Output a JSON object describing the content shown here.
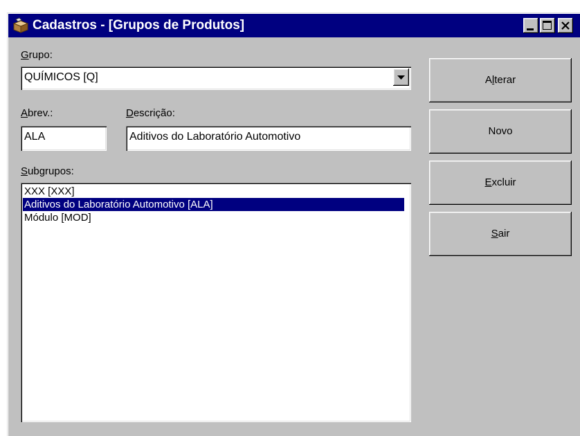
{
  "window": {
    "title": "Cadastros - [Grupos de Produtos]",
    "icon": "boxes-icon",
    "controls": [
      "minimize-icon",
      "maximize-icon",
      "close-icon"
    ]
  },
  "form": {
    "grupo": {
      "label_u": "G",
      "label_rest": "rupo:",
      "value": "QUÍMICOS [Q]"
    },
    "abrev": {
      "label_u": "A",
      "label_rest": "brev.:",
      "value": "ALA"
    },
    "descricao": {
      "label_u": "D",
      "label_rest": "escrição:",
      "value": "Aditivos do Laboratório Automotivo"
    },
    "subgrupos": {
      "label_u": "S",
      "label_rest": "ubgrupos:",
      "items": [
        {
          "label": "XXX [XXX]",
          "selected": false
        },
        {
          "label": "Aditivos do Laboratório Automotivo [ALA]",
          "selected": true
        },
        {
          "label": "Módulo [MOD]",
          "selected": false
        }
      ]
    }
  },
  "buttons": {
    "alterar": {
      "pre": "A",
      "u": "l",
      "post": "terar"
    },
    "novo": {
      "pre": "Novo",
      "u": "",
      "post": ""
    },
    "excluir": {
      "pre": "",
      "u": "E",
      "post": "xcluir"
    },
    "sair": {
      "pre": "",
      "u": "S",
      "post": "air"
    }
  },
  "colors": {
    "titlebar": "#000080",
    "face": "#c0c0c0",
    "selection": "#000080"
  }
}
